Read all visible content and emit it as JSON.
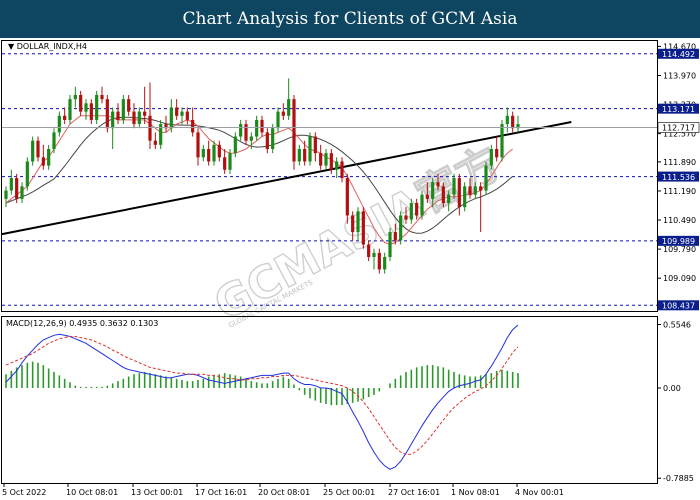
{
  "header": {
    "title": "Chart Analysis for Clients of GCM Asia"
  },
  "watermark": {
    "text": "GCMASIA官方",
    "subtext": "GLOBAL CAPITAL MARKETS"
  },
  "chart_data": [
    {
      "type": "candlestick",
      "symbol_label": "DOLLAR_INDX,H4",
      "ylim": [
        108.3,
        114.8
      ],
      "y_ticks": [
        "114.670",
        "113.970",
        "113.270",
        "112.570",
        "111.890",
        "111.190",
        "110.490",
        "109.790",
        "109.090"
      ],
      "x_ticks": [
        "5 Oct 2022",
        "10 Oct 08:01",
        "13 Oct 00:01",
        "17 Oct 16:01",
        "20 Oct 08:01",
        "25 Oct 00:01",
        "27 Oct 16:01",
        "1 Nov 08:01",
        "4 Nov 00:01"
      ],
      "levels": [
        {
          "value": 114.492,
          "label": "114.492",
          "style": "dashed",
          "color": "#1010b0"
        },
        {
          "value": 113.171,
          "label": "113.171",
          "style": "dashed",
          "color": "#1010b0"
        },
        {
          "value": 111.536,
          "label": "111.536",
          "style": "dashed",
          "color": "#1010b0"
        },
        {
          "value": 109.989,
          "label": "109.989",
          "style": "dashed",
          "color": "#1010b0"
        },
        {
          "value": 108.437,
          "label": "108.437",
          "style": "dashed",
          "color": "#1010b0"
        }
      ],
      "current_price": {
        "value": 112.717,
        "label": "112.717"
      },
      "trendline": {
        "from": [
          0,
          110.15
        ],
        "to": [
          106,
          112.85
        ]
      },
      "colors": {
        "up": "#1b8a1b",
        "down": "#b01010",
        "ma_fast": "#e06060",
        "ma_slow": "#444444"
      },
      "candles": [
        [
          111.0,
          111.3,
          110.8,
          111.2
        ],
        [
          111.2,
          111.7,
          111.1,
          111.5
        ],
        [
          111.5,
          111.6,
          110.9,
          111.0
        ],
        [
          111.0,
          111.4,
          110.9,
          111.3
        ],
        [
          111.3,
          112.0,
          111.2,
          111.9
        ],
        [
          111.9,
          112.5,
          111.8,
          112.4
        ],
        [
          112.4,
          112.5,
          111.9,
          112.0
        ],
        [
          112.0,
          112.3,
          111.7,
          111.8
        ],
        [
          111.8,
          112.3,
          111.7,
          112.2
        ],
        [
          112.2,
          112.7,
          112.1,
          112.6
        ],
        [
          112.6,
          113.1,
          112.5,
          113.0
        ],
        [
          113.0,
          113.2,
          112.8,
          112.9
        ],
        [
          112.9,
          113.5,
          112.8,
          113.4
        ],
        [
          113.4,
          113.7,
          113.2,
          113.5
        ],
        [
          113.5,
          113.6,
          113.0,
          113.1
        ],
        [
          113.1,
          113.4,
          112.9,
          113.3
        ],
        [
          113.3,
          113.4,
          112.8,
          112.9
        ],
        [
          112.9,
          113.6,
          112.8,
          113.5
        ],
        [
          113.5,
          113.7,
          113.3,
          113.4
        ],
        [
          113.4,
          113.5,
          112.6,
          112.7
        ],
        [
          112.7,
          113.2,
          112.2,
          113.1
        ],
        [
          113.1,
          113.3,
          112.8,
          112.9
        ],
        [
          112.9,
          113.5,
          112.8,
          113.4
        ],
        [
          113.4,
          113.5,
          113.0,
          113.1
        ],
        [
          113.1,
          113.3,
          112.7,
          112.8
        ],
        [
          112.8,
          113.2,
          112.7,
          113.1
        ],
        [
          113.1,
          113.7,
          112.8,
          113.0
        ],
        [
          113.0,
          113.8,
          112.2,
          112.4
        ],
        [
          112.4,
          112.6,
          112.2,
          112.3
        ],
        [
          112.3,
          112.9,
          112.2,
          112.8
        ],
        [
          112.8,
          113.0,
          112.6,
          112.7
        ],
        [
          112.7,
          113.4,
          112.6,
          113.2
        ],
        [
          113.2,
          113.4,
          112.9,
          113.0
        ],
        [
          113.0,
          113.2,
          112.8,
          113.1
        ],
        [
          113.1,
          113.2,
          112.8,
          112.9
        ],
        [
          112.9,
          113.2,
          112.5,
          112.6
        ],
        [
          112.6,
          112.7,
          111.8,
          112.0
        ],
        [
          112.0,
          112.3,
          111.9,
          112.2
        ],
        [
          112.2,
          112.4,
          111.8,
          111.9
        ],
        [
          111.9,
          112.4,
          111.8,
          112.3
        ],
        [
          112.3,
          112.4,
          111.9,
          112.0
        ],
        [
          112.0,
          112.2,
          111.6,
          111.7
        ],
        [
          111.7,
          112.2,
          111.6,
          112.1
        ],
        [
          112.1,
          112.6,
          112.0,
          112.5
        ],
        [
          112.5,
          112.9,
          112.4,
          112.8
        ],
        [
          112.8,
          112.9,
          112.3,
          112.4
        ],
        [
          112.4,
          112.6,
          112.2,
          112.5
        ],
        [
          112.5,
          113.0,
          112.4,
          112.9
        ],
        [
          112.9,
          113.0,
          112.5,
          112.6
        ],
        [
          112.6,
          112.7,
          112.1,
          112.2
        ],
        [
          112.2,
          112.8,
          112.1,
          112.7
        ],
        [
          112.7,
          113.2,
          112.6,
          113.1
        ],
        [
          113.1,
          113.3,
          112.9,
          113.0
        ],
        [
          113.0,
          113.9,
          112.9,
          113.4
        ],
        [
          113.4,
          113.5,
          111.7,
          111.9
        ],
        [
          111.9,
          112.3,
          111.8,
          112.2
        ],
        [
          112.2,
          112.4,
          111.8,
          111.9
        ],
        [
          111.9,
          112.6,
          111.8,
          112.5
        ],
        [
          112.5,
          112.6,
          111.9,
          112.1
        ],
        [
          112.1,
          112.3,
          111.7,
          111.8
        ],
        [
          111.8,
          112.2,
          111.7,
          112.1
        ],
        [
          112.1,
          112.2,
          111.6,
          111.7
        ],
        [
          111.7,
          112.0,
          111.5,
          111.9
        ],
        [
          111.9,
          112.0,
          111.4,
          111.5
        ],
        [
          111.5,
          111.6,
          110.4,
          110.6
        ],
        [
          110.6,
          110.7,
          110.0,
          110.2
        ],
        [
          110.2,
          110.8,
          110.0,
          110.7
        ],
        [
          110.7,
          110.8,
          109.8,
          109.9
        ],
        [
          109.9,
          110.0,
          109.5,
          109.6
        ],
        [
          109.6,
          109.8,
          109.3,
          109.7
        ],
        [
          109.7,
          109.8,
          109.2,
          109.3
        ],
        [
          109.3,
          109.7,
          109.2,
          109.6
        ],
        [
          109.6,
          110.3,
          109.5,
          110.2
        ],
        [
          110.2,
          110.4,
          109.9,
          110.0
        ],
        [
          110.0,
          110.7,
          109.9,
          110.6
        ],
        [
          110.6,
          110.8,
          110.4,
          110.5
        ],
        [
          110.5,
          111.0,
          110.4,
          110.9
        ],
        [
          110.9,
          111.0,
          110.5,
          110.6
        ],
        [
          110.6,
          111.2,
          110.5,
          111.1
        ],
        [
          111.1,
          111.4,
          110.9,
          111.0
        ],
        [
          111.0,
          111.5,
          110.8,
          111.4
        ],
        [
          111.4,
          111.6,
          111.2,
          111.3
        ],
        [
          111.3,
          111.4,
          110.8,
          110.9
        ],
        [
          110.9,
          111.2,
          110.7,
          111.1
        ],
        [
          111.1,
          111.6,
          111.0,
          111.5
        ],
        [
          111.5,
          111.6,
          110.6,
          110.8
        ],
        [
          110.8,
          111.4,
          110.7,
          111.3
        ],
        [
          111.3,
          111.5,
          111.0,
          111.1
        ],
        [
          111.1,
          111.4,
          111.0,
          111.3
        ],
        [
          111.3,
          111.4,
          110.2,
          111.2
        ],
        [
          111.2,
          111.9,
          111.1,
          111.8
        ],
        [
          111.8,
          112.3,
          111.7,
          112.2
        ],
        [
          112.2,
          112.5,
          111.9,
          112.0
        ],
        [
          112.0,
          112.9,
          111.9,
          112.8
        ],
        [
          112.8,
          113.2,
          112.6,
          113.0
        ],
        [
          113.0,
          113.1,
          112.6,
          112.7
        ],
        [
          112.7,
          113.0,
          112.6,
          112.8
        ]
      ],
      "ma_fast": [
        110.9,
        111.0,
        111.1,
        111.2,
        111.3,
        111.5,
        111.7,
        111.9,
        112.0,
        112.2,
        112.4,
        112.6,
        112.8,
        112.9,
        113.0,
        113.0,
        113.0,
        113.0,
        113.0,
        113.0,
        112.95,
        112.9,
        112.9,
        112.9,
        112.9,
        112.9,
        112.9,
        112.8,
        112.7,
        112.6,
        112.6,
        112.7,
        112.8,
        112.85,
        112.9,
        112.85,
        112.75,
        112.6,
        112.45,
        112.35,
        112.25,
        112.15,
        112.1,
        112.1,
        112.15,
        112.2,
        112.3,
        112.4,
        112.5,
        112.55,
        112.55,
        112.6,
        112.65,
        112.7,
        112.6,
        112.45,
        112.3,
        112.2,
        112.15,
        112.1,
        112.0,
        111.95,
        111.85,
        111.75,
        111.55,
        111.3,
        111.05,
        110.8,
        110.55,
        110.3,
        110.1,
        109.95,
        109.9,
        109.95,
        110.05,
        110.15,
        110.3,
        110.45,
        110.6,
        110.75,
        110.85,
        110.95,
        111.0,
        111.05,
        111.05,
        111.05,
        111.1,
        111.1,
        111.15,
        111.2,
        111.35,
        111.55,
        111.75,
        111.95,
        112.1,
        112.2
      ]
    },
    {
      "type": "bar+line",
      "label": "MACD(12,26,9) 0.4935 0.3632 0.1303",
      "ylim": [
        -0.83,
        0.62
      ],
      "y_ticks": [
        "0.5546",
        "0.00",
        "-0.7885"
      ],
      "colors": {
        "histogram": "#2a9a2a",
        "macd": "#1f2fe0",
        "signal": "#e03030"
      },
      "macd": [
        0.05,
        0.1,
        0.15,
        0.22,
        0.28,
        0.33,
        0.38,
        0.42,
        0.44,
        0.46,
        0.47,
        0.46,
        0.45,
        0.43,
        0.41,
        0.39,
        0.36,
        0.33,
        0.3,
        0.27,
        0.24,
        0.21,
        0.18,
        0.16,
        0.15,
        0.14,
        0.13,
        0.12,
        0.11,
        0.1,
        0.09,
        0.09,
        0.1,
        0.11,
        0.12,
        0.12,
        0.11,
        0.09,
        0.07,
        0.06,
        0.05,
        0.04,
        0.05,
        0.06,
        0.07,
        0.08,
        0.09,
        0.1,
        0.11,
        0.11,
        0.11,
        0.12,
        0.13,
        0.13,
        0.08,
        0.05,
        0.03,
        0.03,
        0.02,
        0.0,
        0.0,
        -0.01,
        -0.03,
        -0.05,
        -0.12,
        -0.21,
        -0.29,
        -0.38,
        -0.48,
        -0.56,
        -0.63,
        -0.68,
        -0.71,
        -0.69,
        -0.64,
        -0.57,
        -0.49,
        -0.41,
        -0.33,
        -0.26,
        -0.19,
        -0.13,
        -0.08,
        -0.03,
        0.0,
        0.02,
        0.03,
        0.04,
        0.06,
        0.07,
        0.12,
        0.19,
        0.27,
        0.35,
        0.44,
        0.51,
        0.55
      ],
      "signal": [
        0.2,
        0.22,
        0.24,
        0.26,
        0.28,
        0.3,
        0.33,
        0.36,
        0.39,
        0.41,
        0.43,
        0.44,
        0.45,
        0.45,
        0.44,
        0.43,
        0.42,
        0.4,
        0.38,
        0.36,
        0.33,
        0.31,
        0.28,
        0.26,
        0.24,
        0.22,
        0.2,
        0.18,
        0.17,
        0.16,
        0.15,
        0.14,
        0.13,
        0.13,
        0.12,
        0.12,
        0.12,
        0.12,
        0.11,
        0.11,
        0.1,
        0.09,
        0.08,
        0.08,
        0.07,
        0.07,
        0.08,
        0.08,
        0.09,
        0.09,
        0.1,
        0.1,
        0.11,
        0.11,
        0.11,
        0.1,
        0.09,
        0.08,
        0.07,
        0.06,
        0.05,
        0.04,
        0.03,
        0.02,
        0.0,
        -0.03,
        -0.07,
        -0.12,
        -0.18,
        -0.25,
        -0.32,
        -0.39,
        -0.46,
        -0.52,
        -0.56,
        -0.58,
        -0.58,
        -0.55,
        -0.51,
        -0.46,
        -0.4,
        -0.34,
        -0.28,
        -0.22,
        -0.17,
        -0.13,
        -0.09,
        -0.06,
        -0.03,
        -0.01,
        0.02,
        0.06,
        0.11,
        0.17,
        0.24,
        0.31,
        0.36
      ],
      "histogram": [
        0.12,
        0.15,
        0.18,
        0.2,
        0.22,
        0.23,
        0.22,
        0.2,
        0.17,
        0.14,
        0.11,
        0.08,
        0.05,
        0.02,
        0.01,
        0.01,
        0.01,
        0.01,
        0.01,
        0.02,
        0.04,
        0.06,
        0.08,
        0.1,
        0.12,
        0.13,
        0.14,
        0.13,
        0.12,
        0.11,
        0.1,
        0.09,
        0.08,
        0.07,
        0.06,
        0.06,
        0.07,
        0.08,
        0.1,
        0.11,
        0.12,
        0.13,
        0.12,
        0.11,
        0.1,
        0.08,
        0.06,
        0.05,
        0.04,
        0.04,
        0.06,
        0.08,
        0.1,
        0.08,
        0.03,
        -0.02,
        -0.06,
        -0.09,
        -0.11,
        -0.13,
        -0.14,
        -0.15,
        -0.15,
        -0.15,
        -0.14,
        -0.13,
        -0.12,
        -0.1,
        -0.08,
        -0.06,
        -0.03,
        0.0,
        0.04,
        0.08,
        0.11,
        0.14,
        0.16,
        0.18,
        0.19,
        0.2,
        0.2,
        0.19,
        0.18,
        0.16,
        0.14,
        0.12,
        0.11,
        0.1,
        0.1,
        0.11,
        0.12,
        0.13,
        0.15,
        0.16,
        0.15,
        0.14,
        0.13
      ]
    }
  ]
}
